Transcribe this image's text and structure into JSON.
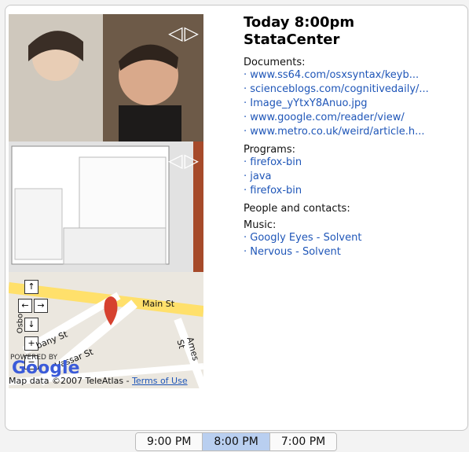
{
  "time_label": "Today 8:00pm",
  "location_label": "StataCenter",
  "sections": {
    "documents": {
      "label": "Documents:",
      "items": [
        "www.ss64.com/osxsyntax/keyb...",
        "scienceblogs.com/cognitivedaily/...",
        "Image_yYtxY8Anuo.jpg",
        "www.google.com/reader/view/",
        "www.metro.co.uk/weird/article.h..."
      ]
    },
    "programs": {
      "label": "Programs:",
      "items": [
        "firefox-bin",
        "java",
        "firefox-bin"
      ]
    },
    "people": {
      "label": "People and contacts:"
    },
    "music": {
      "label": "Music:",
      "items": [
        "Googly Eyes - Solvent",
        "Nervous - Solvent"
      ]
    }
  },
  "map": {
    "labels": [
      "Main St",
      "bany St",
      "Vassar St",
      "Ames St",
      "Osbo"
    ],
    "attribution": "Map data ©2007 TeleAtlas",
    "terms": "Terms of Use",
    "powered": "POWERED BY",
    "google": "Google"
  },
  "time_tabs": [
    "9:00 PM",
    "8:00 PM",
    "7:00 PM"
  ],
  "active_tab_index": 1,
  "colors": {
    "link": "#1f56b8",
    "active_tab": "#b9cff0"
  }
}
